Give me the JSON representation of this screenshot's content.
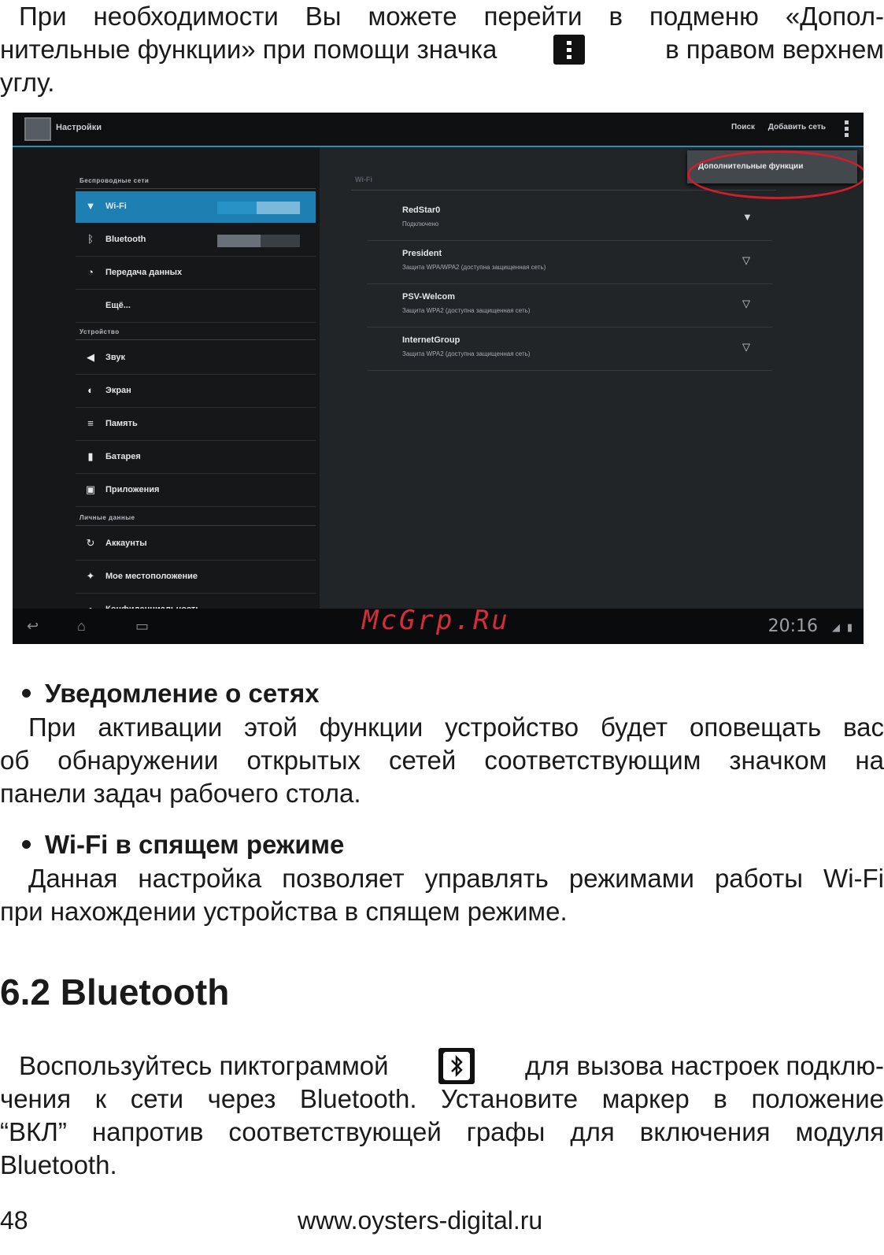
{
  "intro": {
    "lines": [
      "При необходимости Вы можете перейти в подменю «Допол-",
      "нительные функции» при помощи значка",
      "в правом верхнем",
      "углу."
    ],
    "menu_icon": "vertical-dots-menu-icon"
  },
  "screenshot": {
    "app_title": "Настройки",
    "actions": [
      "Поиск",
      "Добавить сеть"
    ],
    "overflow_popup": "Дополнительные функции",
    "sections": [
      "Беспроводные сети",
      "Устройство",
      "Личные данные"
    ],
    "items": [
      {
        "label": "Wi-Fi",
        "icon": "wifi-icon",
        "toggle": "ВКЛ"
      },
      {
        "label": "Bluetooth",
        "icon": "bluetooth-icon",
        "toggle": "ВЫКЛ"
      },
      {
        "label": "Передача данных",
        "icon": "data-usage-icon"
      },
      {
        "label": "Ещё...",
        "icon": ""
      },
      {
        "label": "Звук",
        "icon": "sound-icon"
      },
      {
        "label": "Экран",
        "icon": "display-icon"
      },
      {
        "label": "Память",
        "icon": "storage-icon"
      },
      {
        "label": "Батарея",
        "icon": "battery-icon"
      },
      {
        "label": "Приложения",
        "icon": "apps-icon"
      },
      {
        "label": "Аккаунты",
        "icon": "accounts-icon"
      },
      {
        "label": "Мое местоположение",
        "icon": "location-icon"
      },
      {
        "label": "Конфиденциальность",
        "icon": "privacy-icon"
      }
    ],
    "wifi_header": "Wi-Fi",
    "networks": [
      {
        "name": "RedStar0",
        "status": "Подключено"
      },
      {
        "name": "President",
        "status": "Защита WPA/WPA2 (доступна защищенная сеть)"
      },
      {
        "name": "PSV-Welcom",
        "status": "Защита WPA2 (доступна защищенная сеть)"
      },
      {
        "name": "InternetGroup",
        "status": "Защита WPA2 (доступна защищенная сеть)"
      }
    ],
    "clock": "20:16",
    "watermark": "McGrp.Ru",
    "highlight_color": "#d21e2a",
    "accent_color": "#1e7fb2"
  },
  "section1": {
    "heading": "Уведомление о сетях",
    "lines": [
      "При активации этой функции устройство будет оповещать вас",
      "об обнаружении открытых сетей соответствующим значком на",
      "панели задач рабочего стола."
    ]
  },
  "section2": {
    "heading": "Wi-Fi в спящем режиме",
    "lines": [
      "Данная настройка позволяет управлять режимами работы Wi-Fi",
      "при нахождении устройства в спящем режиме."
    ]
  },
  "bt": {
    "title": "6.2 Bluetooth",
    "line1a": "Воспользуйтесь пиктограммой",
    "line1b": "для вызова настроек подклю-",
    "lines": [
      "чения к сети через Bluetooth. Установите маркер в положение",
      "“ВКЛ” напротив соответствующей графы для включения модуля",
      "Bluetooth."
    ],
    "icon": "bluetooth-icon"
  },
  "footer": {
    "page": "48",
    "url": "www.oysters-digital.ru"
  }
}
